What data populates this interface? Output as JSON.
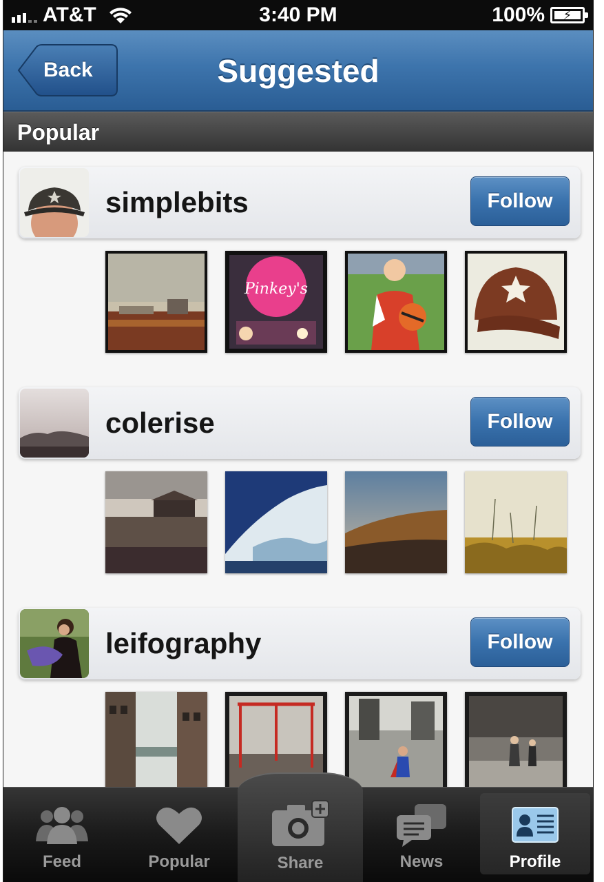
{
  "status_bar": {
    "carrier": "AT&T",
    "time": "3:40 PM",
    "battery": "100%"
  },
  "nav": {
    "back_label": "Back",
    "title": "Suggested"
  },
  "section": {
    "title": "Popular"
  },
  "users": [
    {
      "username": "simplebits",
      "follow_label": "Follow"
    },
    {
      "username": "colerise",
      "follow_label": "Follow"
    },
    {
      "username": "leifography",
      "follow_label": "Follow"
    }
  ],
  "tabs": [
    {
      "label": "Feed",
      "icon": "people-icon"
    },
    {
      "label": "Popular",
      "icon": "heart-icon"
    },
    {
      "label": "Share",
      "icon": "camera-plus-icon"
    },
    {
      "label": "News",
      "icon": "speech-bubbles-icon"
    },
    {
      "label": "Profile",
      "icon": "id-card-icon",
      "active": true
    }
  ],
  "colors": {
    "nav_blue": "#3d74ac",
    "follow_blue": "#3a72ad",
    "tabbar_dark": "#1a1a1a"
  }
}
